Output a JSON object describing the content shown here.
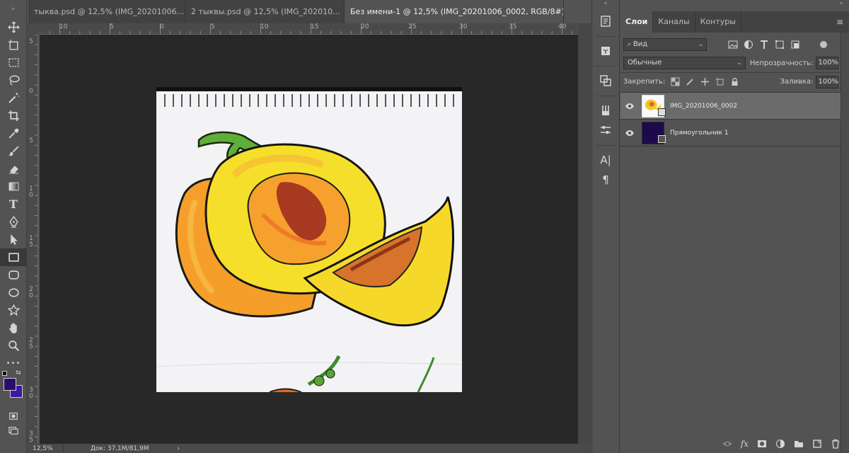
{
  "document_tabs": [
    {
      "label": "тыква.psd @ 12,5% (IMG_20201006...",
      "close": "×",
      "active": false
    },
    {
      "label": "2 тыквы.psd @ 12,5% (IMG_202010...",
      "close": "×",
      "active": false
    },
    {
      "label": "Без имени-1 @ 12,5% (IMG_20201006_0002, RGB/8#) *",
      "close": "×",
      "active": true
    }
  ],
  "ruler_top": [
    "10",
    "5",
    "0",
    "5",
    "10",
    "15",
    "20",
    "25",
    "30",
    "35",
    "40"
  ],
  "ruler_left": [
    "5",
    "0",
    "5",
    "1 0",
    "1 5",
    "2 0",
    "2 5",
    "3 0",
    "3 5"
  ],
  "tools": [
    "move-tool",
    "artboard-tool",
    "marquee-tool",
    "lasso-tool",
    "magic-wand-tool",
    "crop-tool",
    "eyedropper-tool",
    "brush-tool",
    "eraser-tool",
    "gradient-tool",
    "type-tool",
    "pen-tool",
    "path-selection-tool",
    "rectangle-tool",
    "rounded-rectangle-tool",
    "ellipse-tool",
    "custom-shape-tool",
    "hand-tool",
    "zoom-tool",
    "more-tools"
  ],
  "tool_text": {
    "type": "T",
    "more": "•••"
  },
  "colors": {
    "foreground": "#2a0e6a",
    "background": "#3b1aa0",
    "accent_selected": "#6b6b6b",
    "pasteboard": "#282828"
  },
  "status": {
    "zoom": "12,5%",
    "doc": "Док: 37,1M/81,9M",
    "arrow": "›"
  },
  "grips": {
    "collapse_left": "«",
    "collapse_right": "»"
  },
  "panel": {
    "tabs": [
      {
        "label": "Слои",
        "active": true
      },
      {
        "label": "Каналы",
        "active": false
      },
      {
        "label": "Контуры",
        "active": false
      }
    ],
    "menu_icon": "≡",
    "filter_kind": "Вид",
    "blend_mode": "Обычные",
    "opacity_label": "Непрозрачность:",
    "opacity_value": "100%",
    "lock_label": "Закрепить:",
    "fill_label": "Заливка:",
    "fill_value": "100%",
    "caret": "⌄",
    "dropdown": "▾",
    "layers": [
      {
        "name": "IMG_20201006_0002",
        "selected": true,
        "thumb": "pumpkin-thumbnail"
      },
      {
        "name": "Прямоугольник 1",
        "selected": false,
        "thumb_color": "#1e0a4a"
      }
    ],
    "bottom_icons": [
      "link-icon",
      "fx-icon",
      "mask-icon",
      "adjustment-icon",
      "group-icon",
      "new-layer-icon",
      "trash-icon"
    ],
    "fx_text": "fx"
  },
  "dock_icons": [
    "history-icon",
    "3d-icon",
    "properties-icon",
    "brushes-icon",
    "adjustments-icon",
    "character-icon",
    "paragraph-icon"
  ],
  "dock_text": {
    "character": "A|",
    "paragraph": "¶"
  }
}
